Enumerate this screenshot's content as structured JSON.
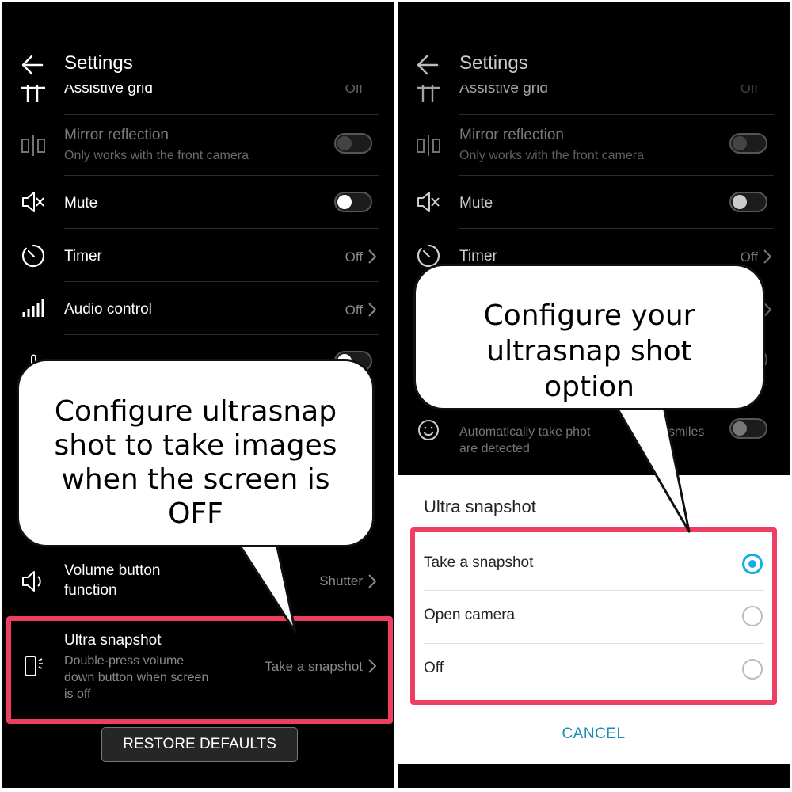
{
  "left": {
    "title": "Settings",
    "items": {
      "assistive_grid": {
        "label": "Assistive grid",
        "value": "Off"
      },
      "mirror": {
        "label": "Mirror reflection",
        "sub": "Only works with the front camera"
      },
      "mute": {
        "label": "Mute"
      },
      "timer": {
        "label": "Timer",
        "value": "Off"
      },
      "audio": {
        "label": "Audio control",
        "value": "Off"
      },
      "volume": {
        "label_1": "Volume button",
        "label_2": "function",
        "value": "Shutter"
      },
      "ultra": {
        "label": "Ultra snapshot",
        "sub_1": "Double-press volume",
        "sub_2": "down button when screen",
        "sub_3": "is off",
        "value": "Take a snapshot"
      }
    },
    "restore_label": "RESTORE DEFAULTS",
    "callout": [
      "Configure ultrasnap",
      "shot to take images",
      "when the screen is",
      "OFF"
    ]
  },
  "right": {
    "title": "Settings",
    "items": {
      "assistive_grid": {
        "label": "Assistive grid",
        "value": "Off"
      },
      "mirror": {
        "label": "Mirror reflection",
        "sub": "Only works with the front camera"
      },
      "mute": {
        "label": "Mute"
      },
      "timer": {
        "label": "Timer",
        "value": "Off"
      },
      "smile": {
        "sub_1": "Automatically take phot",
        "sub_1b": "smiles",
        "sub_2": "are detected"
      }
    },
    "callout": [
      "Configure your",
      "ultrasnap shot",
      "option"
    ],
    "dialog": {
      "title": "Ultra snapshot",
      "options": [
        "Take a snapshot",
        "Open camera",
        "Off"
      ],
      "selected": "Take a snapshot",
      "cancel_label": "CANCEL"
    }
  },
  "colors": {
    "highlight": "#ee3e62",
    "accent": "#13aee6",
    "cancel": "#1a8cb3"
  }
}
